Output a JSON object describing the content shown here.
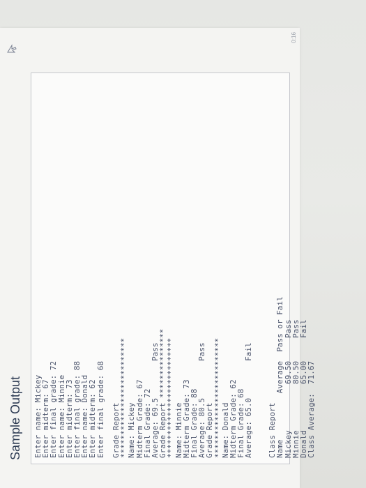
{
  "document": {
    "heading": "Sample Output",
    "page_number": "0:16",
    "lines": [
      "Enter name: Mickey",
      "Enter midterm: 67",
      "Enter final grade: 72",
      "Enter name: Minnie",
      "Enter midterm: 73",
      "Enter final grade: 88",
      "Enter name: Donald",
      "Enter midterm: 62",
      "Enter final grade: 68",
      "",
      "Grade Report",
      "**************************",
      "Name: Mickey",
      "Midterm Grade: 67",
      "Final Grade: 72",
      "Average: 69.5        Pass",
      "Grade Report ***************",
      "**************************",
      "Name: Minnie",
      "Midterm Grade: 73",
      "Final Grade: 88",
      "Average: 80.5        Pass",
      "Grade Report",
      "**************************",
      "Name: Donald",
      "Midterm Grade: 62",
      "Final Grade: 68",
      "Average: 65.0        Fail",
      "",
      "",
      "Class Report",
      "Name          Average  Pass or Fail",
      "Mickey          69.50     Pass",
      "Minnie          80.50     Pass",
      "Donald          65.00     Fail",
      "Class Average:  71.67"
    ]
  }
}
